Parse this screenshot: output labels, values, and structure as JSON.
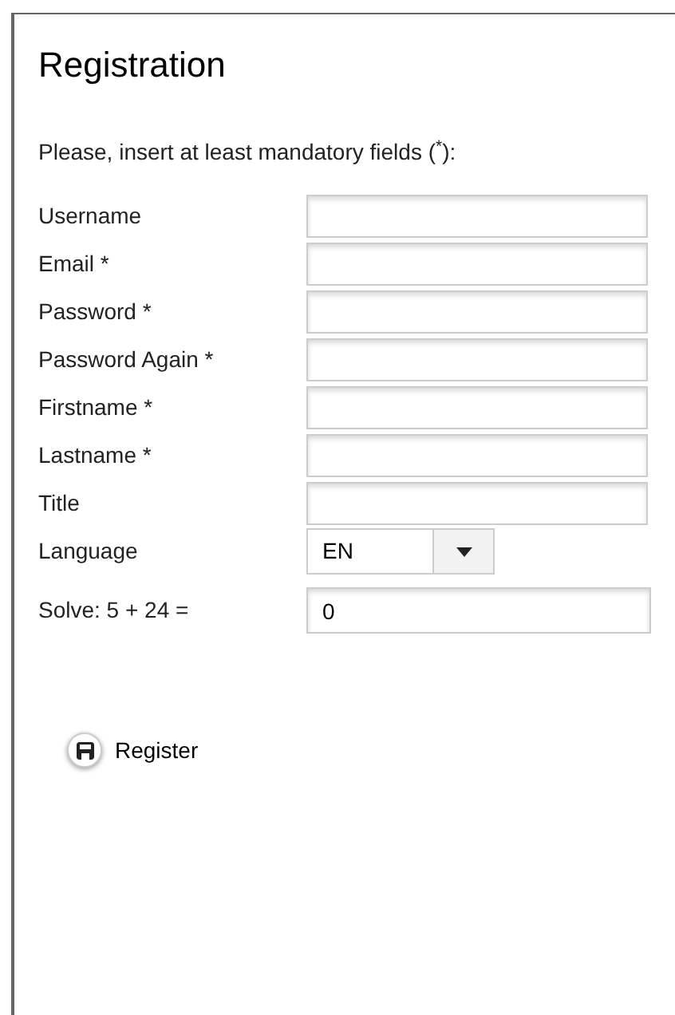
{
  "title": "Registration",
  "instructions": "Please, insert at least mandatory fields ($^{*}$):",
  "fields": [
    {
      "kind": "text",
      "label": "Username"
    },
    {
      "kind": "text",
      "label": "Email *"
    },
    {
      "kind": "text",
      "label": "Password *"
    },
    {
      "kind": "text",
      "label": "Password Again *"
    },
    {
      "kind": "text",
      "label": "Firstname *"
    },
    {
      "kind": "text",
      "label": "Lastname *"
    },
    {
      "kind": "text",
      "label": "Title"
    },
    {
      "kind": "select",
      "label": "Language",
      "value": "EN"
    }
  ],
  "captcha": {
    "label": "Solve: 5 + 24 =",
    "value": "0"
  },
  "register_button": "Register"
}
